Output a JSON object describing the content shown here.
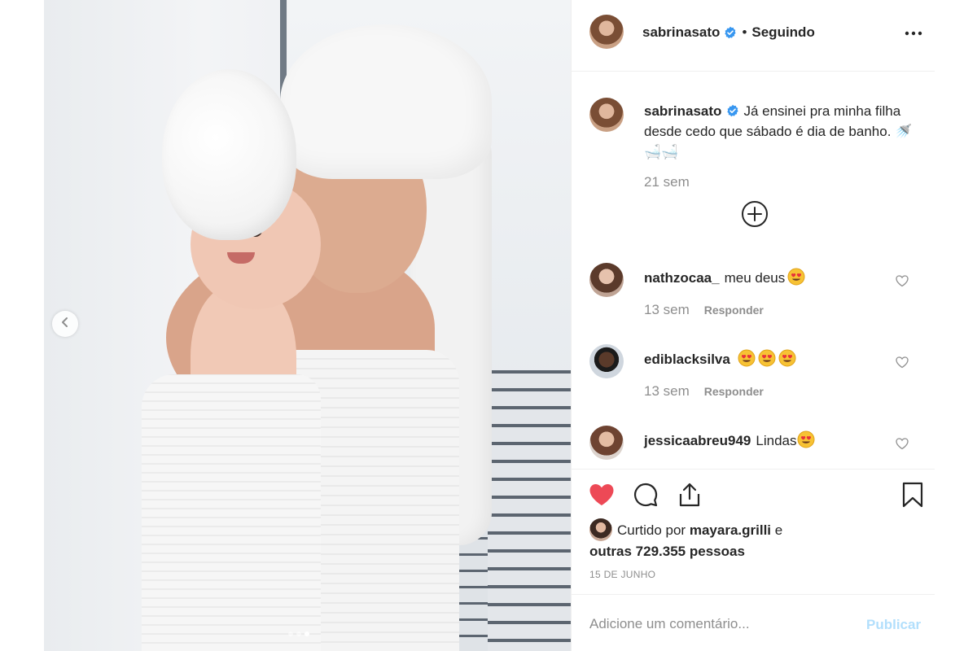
{
  "post": {
    "author": {
      "username": "sabrinasato",
      "verified": true,
      "separator": "•",
      "follow_status": "Seguindo"
    },
    "photo": {
      "carousel_total": 3,
      "carousel_active_index": 2
    },
    "caption": {
      "username": "sabrinasato",
      "text": "Já ensinei pra minha filha desde cedo que sábado é dia de banho. 🚿🛁🛁",
      "time": "21 sem"
    },
    "comments": [
      {
        "username": "nathzocaa_",
        "text": "meu deus",
        "emoji_count": 1,
        "time": "13 sem",
        "reply_label": "Responder"
      },
      {
        "username": "ediblacksilva",
        "text": "",
        "emoji_count": 3,
        "time": "13 sem",
        "reply_label": "Responder"
      },
      {
        "username": "jessicaabreu949",
        "text": "Lindas",
        "emoji_count": 1,
        "time": "",
        "reply_label": ""
      }
    ],
    "likes": {
      "prefix": "Curtido por",
      "liker": "mayara.grilli",
      "conj": "e",
      "others": "outras 729.355 pessoas"
    },
    "date": "15 DE JUNHO",
    "add_comment": {
      "placeholder": "Adicione um comentário...",
      "publish_label": "Publicar"
    },
    "liked": true,
    "colors": {
      "like_red": "#ed4956",
      "verified_blue": "#3897f0",
      "muted": "#8e8e8e",
      "publish_disabled": "#b2dffc"
    },
    "icons": [
      "more-icon",
      "verified-icon",
      "plus-circle-icon",
      "heart-icon",
      "comment-icon",
      "share-icon",
      "bookmark-icon",
      "chevron-left-icon"
    ]
  }
}
